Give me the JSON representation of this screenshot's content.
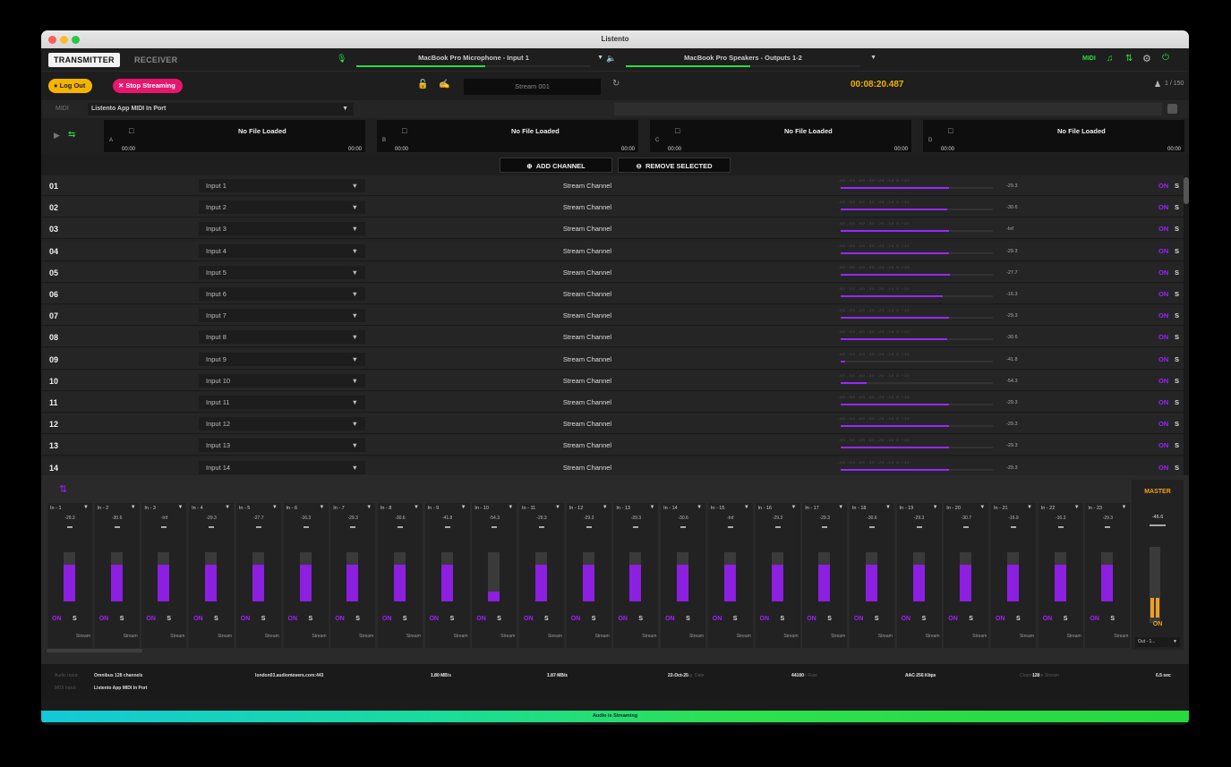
{
  "window": {
    "title": "Listento"
  },
  "tabs": {
    "transmitter": "TRANSMITTER",
    "receiver": "RECEIVER"
  },
  "input_device": {
    "name": "MacBook Pro Microphone - Input 1",
    "level": 0.55
  },
  "output_device": {
    "name": "MacBook Pro Speakers - Outputs 1-2",
    "level": 0.53
  },
  "header_right": {
    "midi": "MIDI"
  },
  "controls": {
    "logout": "Log Out",
    "stop_streaming": "Stop Streaming",
    "stream_name": "Stream 001",
    "timer": "00:08:20.487",
    "listeners": "1 / 150"
  },
  "midi_bar": {
    "label": "MIDI",
    "port": "Listento App MIDI In Port"
  },
  "players": [
    {
      "letter": "A",
      "title": "No File Loaded",
      "start": "00:00",
      "end": "00:00"
    },
    {
      "letter": "B",
      "title": "No File Loaded",
      "start": "00:00",
      "end": "00:00"
    },
    {
      "letter": "C",
      "title": "No File Loaded",
      "start": "00:00",
      "end": "00:00"
    },
    {
      "letter": "D",
      "title": "No File Loaded",
      "start": "00:00",
      "end": "00:00"
    }
  ],
  "buttons": {
    "add_channel": "ADD CHANNEL",
    "remove_selected": "REMOVE SELECTED"
  },
  "channels": [
    {
      "num": "01",
      "input": "Input 1",
      "type": "Stream Channel",
      "db": "-29.3",
      "level": 0.71,
      "on": "ON",
      "s": "S"
    },
    {
      "num": "02",
      "input": "Input 2",
      "type": "Stream Channel",
      "db": "-30.6",
      "level": 0.7,
      "on": "ON",
      "s": "S"
    },
    {
      "num": "03",
      "input": "Input 3",
      "type": "Stream Channel",
      "db": "-Inf",
      "level": 0.71,
      "on": "ON",
      "s": "S"
    },
    {
      "num": "04",
      "input": "Input 4",
      "type": "Stream Channel",
      "db": "-29.3",
      "level": 0.71,
      "on": "ON",
      "s": "S"
    },
    {
      "num": "05",
      "input": "Input 5",
      "type": "Stream Channel",
      "db": "-27.7",
      "level": 0.72,
      "on": "ON",
      "s": "S"
    },
    {
      "num": "06",
      "input": "Input 6",
      "type": "Stream Channel",
      "db": "-16.3",
      "level": 0.67,
      "on": "ON",
      "s": "S"
    },
    {
      "num": "07",
      "input": "Input 7",
      "type": "Stream Channel",
      "db": "-29.3",
      "level": 0.71,
      "on": "ON",
      "s": "S"
    },
    {
      "num": "08",
      "input": "Input 8",
      "type": "Stream Channel",
      "db": "-30.6",
      "level": 0.7,
      "on": "ON",
      "s": "S"
    },
    {
      "num": "09",
      "input": "Input 9",
      "type": "Stream Channel",
      "db": "-41.8",
      "level": 0.03,
      "on": "ON",
      "s": "S"
    },
    {
      "num": "10",
      "input": "Input 10",
      "type": "Stream Channel",
      "db": "-54.3",
      "level": 0.17,
      "on": "ON",
      "s": "S"
    },
    {
      "num": "11",
      "input": "Input 11",
      "type": "Stream Channel",
      "db": "-29.3",
      "level": 0.71,
      "on": "ON",
      "s": "S"
    },
    {
      "num": "12",
      "input": "Input 12",
      "type": "Stream Channel",
      "db": "-29.3",
      "level": 0.71,
      "on": "ON",
      "s": "S"
    },
    {
      "num": "13",
      "input": "Input 13",
      "type": "Stream Channel",
      "db": "-29.3",
      "level": 0.71,
      "on": "ON",
      "s": "S"
    },
    {
      "num": "14",
      "input": "Input 14",
      "type": "Stream Channel",
      "db": "-29.3",
      "level": 0.71,
      "on": "ON",
      "s": "S"
    }
  ],
  "meter_scale": "-60  -50  -40  -30  -20  -10   0  +10",
  "mixer": {
    "strips": [
      {
        "name": "In - 1",
        "db": "-29.3",
        "level": 0.75,
        "on": "ON",
        "s": "S",
        "stream": "Stream"
      },
      {
        "name": "In - 2",
        "db": "-30.6",
        "level": 0.75,
        "on": "ON",
        "s": "S",
        "stream": "Stream"
      },
      {
        "name": "In - 3",
        "db": "-Inf",
        "level": 0.75,
        "on": "ON",
        "s": "S",
        "stream": "Stream"
      },
      {
        "name": "In - 4",
        "db": "-29.3",
        "level": 0.75,
        "on": "ON",
        "s": "S",
        "stream": "Stream"
      },
      {
        "name": "In - 5",
        "db": "-27.7",
        "level": 0.75,
        "on": "ON",
        "s": "S",
        "stream": "Stream"
      },
      {
        "name": "In - 6",
        "db": "-16.3",
        "level": 0.75,
        "on": "ON",
        "s": "S",
        "stream": "Stream"
      },
      {
        "name": "In - 7",
        "db": "-29.3",
        "level": 0.75,
        "on": "ON",
        "s": "S",
        "stream": "Stream"
      },
      {
        "name": "In - 8",
        "db": "-30.6",
        "level": 0.75,
        "on": "ON",
        "s": "S",
        "stream": "Stream"
      },
      {
        "name": "In - 9",
        "db": "-41.8",
        "level": 0.75,
        "on": "ON",
        "s": "S",
        "stream": "Stream"
      },
      {
        "name": "In - 10",
        "db": "-54.3",
        "level": 0.2,
        "on": "ON",
        "s": "S",
        "stream": "Stream"
      },
      {
        "name": "In - 11",
        "db": "-29.3",
        "level": 0.75,
        "on": "ON",
        "s": "S",
        "stream": "Stream"
      },
      {
        "name": "In - 12",
        "db": "-29.3",
        "level": 0.75,
        "on": "ON",
        "s": "S",
        "stream": "Stream"
      },
      {
        "name": "In - 13",
        "db": "-29.3",
        "level": 0.75,
        "on": "ON",
        "s": "S",
        "stream": "Stream"
      },
      {
        "name": "In - 14",
        "db": "-30.6",
        "level": 0.75,
        "on": "ON",
        "s": "S",
        "stream": "Stream"
      },
      {
        "name": "In - 15",
        "db": "-Inf",
        "level": 0.75,
        "on": "ON",
        "s": "S",
        "stream": "Stream"
      },
      {
        "name": "In - 16",
        "db": "-29.3",
        "level": 0.75,
        "on": "ON",
        "s": "S",
        "stream": "Stream"
      },
      {
        "name": "In - 17",
        "db": "-29.3",
        "level": 0.75,
        "on": "ON",
        "s": "S",
        "stream": "Stream"
      },
      {
        "name": "In - 18",
        "db": "-30.6",
        "level": 0.75,
        "on": "ON",
        "s": "S",
        "stream": "Stream"
      },
      {
        "name": "In - 19",
        "db": "-29.3",
        "level": 0.75,
        "on": "ON",
        "s": "S",
        "stream": "Stream"
      },
      {
        "name": "In - 20",
        "db": "-30.7",
        "level": 0.75,
        "on": "ON",
        "s": "S",
        "stream": "Stream"
      },
      {
        "name": "In - 21",
        "db": "-16.9",
        "level": 0.75,
        "on": "ON",
        "s": "S",
        "stream": "Stream"
      },
      {
        "name": "In - 22",
        "db": "-16.3",
        "level": 0.75,
        "on": "ON",
        "s": "S",
        "stream": "Stream"
      },
      {
        "name": "In - 23",
        "db": "-29.3",
        "level": 0.75,
        "on": "ON",
        "s": "S",
        "stream": "Stream"
      }
    ],
    "master": {
      "label": "MASTER",
      "db": "-46.6",
      "on": "ON",
      "output": "Out - 1..."
    }
  },
  "stats": [
    {
      "label": "Audio Input:",
      "value": "Omnibus 128 channels"
    },
    {
      "label": "Server",
      "value": "london03.audiomovers.com:443"
    },
    {
      "label": "Upload",
      "value": "1.80 MB/s"
    },
    {
      "label": "Download",
      "value": "1.87 MB/s"
    },
    {
      "label": "License Exp. Date",
      "value": "22-Oct-25"
    },
    {
      "label": "Sample Rate",
      "value": "44100"
    },
    {
      "label": "Stream Quality",
      "value": "AAC 256 Kbps"
    },
    {
      "label": "Channels in Stream",
      "value": "128"
    },
    {
      "label": "Latency",
      "value": "6.5 sec"
    }
  ],
  "midi_input": {
    "label": "MIDI Input:",
    "value": "Listento App MIDI In Port"
  },
  "status": "Audio is Streaming",
  "colors": {
    "accent": "#9a28ff",
    "green": "#22e03f",
    "logout": "#f5b400",
    "stop": "#e8166f",
    "timer": "#f0b400"
  }
}
